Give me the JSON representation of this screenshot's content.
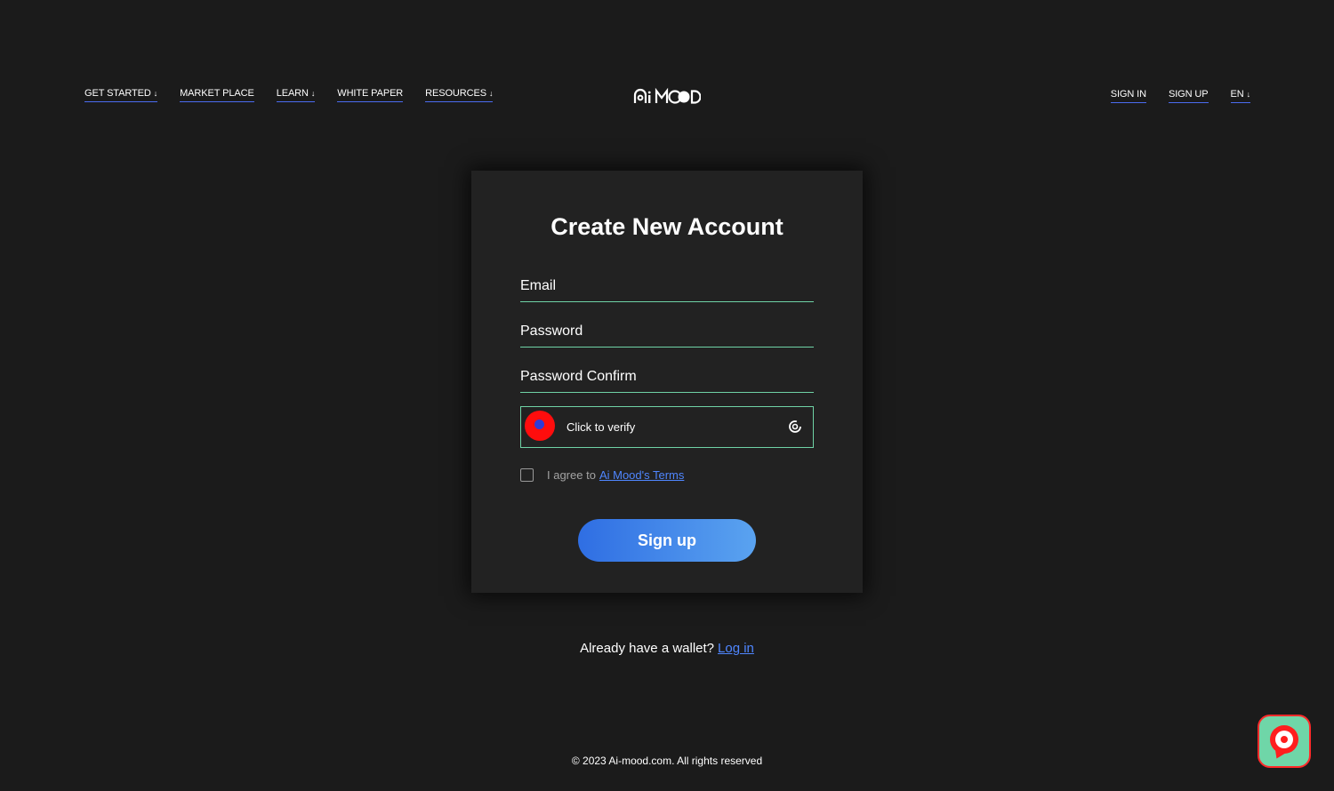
{
  "header": {
    "nav_left": [
      {
        "label": "GET STARTED",
        "arrow": "↓"
      },
      {
        "label": "MARKET PLACE",
        "arrow": ""
      },
      {
        "label": "LEARN",
        "arrow": "↓"
      },
      {
        "label": "WHITE PAPER",
        "arrow": ""
      },
      {
        "label": "RESOURCES",
        "arrow": "↓"
      }
    ],
    "logo_name": "Ai Mood logo",
    "nav_right": [
      {
        "label": "SIGN IN",
        "arrow": ""
      },
      {
        "label": "SIGN UP",
        "arrow": ""
      },
      {
        "label": "EN",
        "arrow": "↓"
      }
    ]
  },
  "form": {
    "title": "Create New Account",
    "email_placeholder": "Email",
    "password_placeholder": "Password",
    "password_confirm_placeholder": "Password Confirm",
    "captcha_text": "Click to verify",
    "terms_prefix": "I agree to",
    "terms_link": "Ai Mood's Terms",
    "submit_label": "Sign up"
  },
  "login": {
    "prompt": "Already have a wallet?",
    "link": "Log in"
  },
  "footer": {
    "copyright": "© 2023 Ai-mood.com. All rights reserved"
  },
  "colors": {
    "background": "#1b1b1b",
    "card": "#222222",
    "accent_green": "#6fd3a6",
    "link_blue": "#4f86ff",
    "button_gradient_start": "#2f6ee3",
    "button_gradient_end": "#5aa3f0"
  },
  "icons": {
    "captcha_refresh": "refresh-icon",
    "chat_widget": "chat-support-icon"
  }
}
